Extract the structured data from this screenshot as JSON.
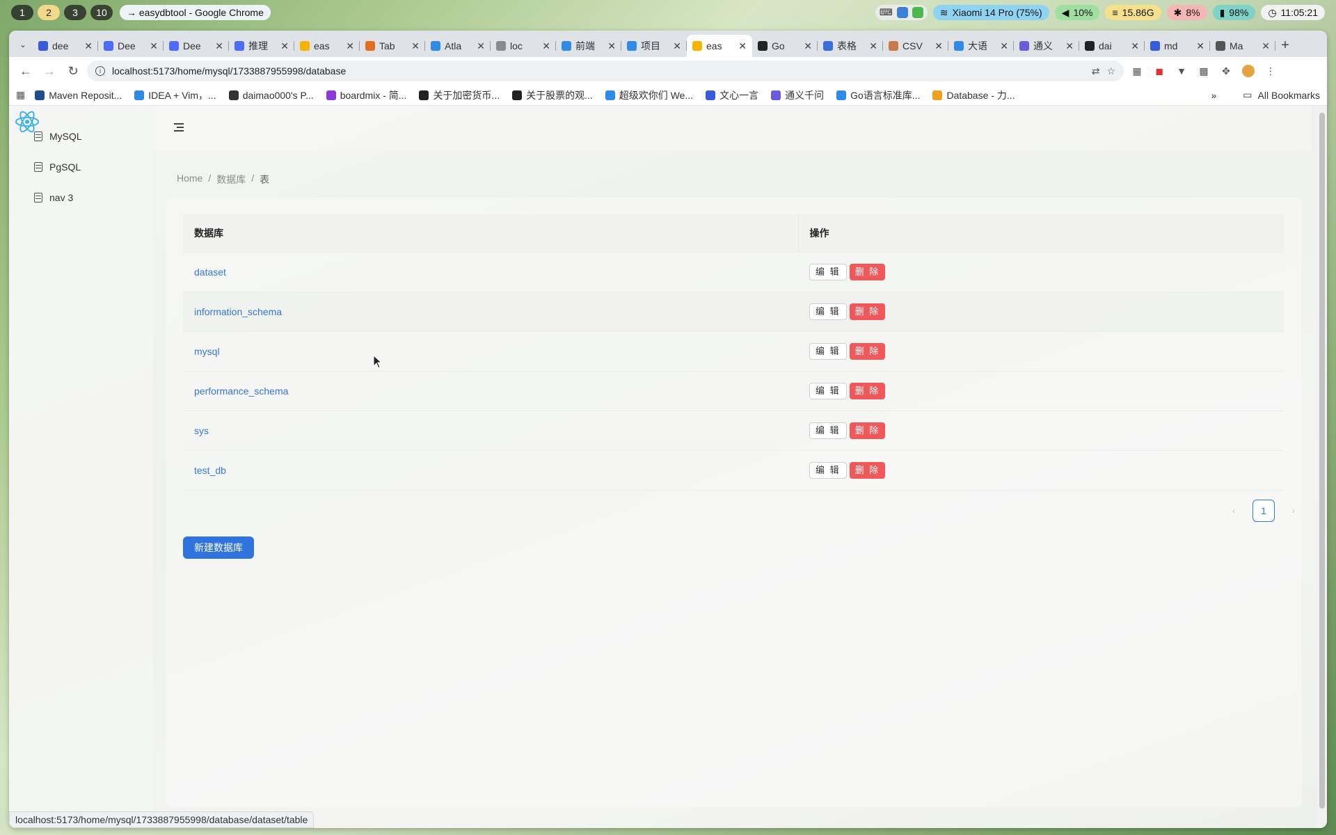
{
  "system_bar": {
    "workspaces": [
      "1",
      "2",
      "3",
      "10"
    ],
    "active_workspace": "2",
    "window_title": "→ easydbtool - Google Chrome",
    "wifi": "Xiaomi 14 Pro (75%)",
    "volume": "10%",
    "memory": "15.86G",
    "cpu": "8%",
    "battery": "98%",
    "clock": "11:05:21"
  },
  "tabs": [
    {
      "label": "dee",
      "icon": "paw-icon",
      "color": "#3a5bd9"
    },
    {
      "label": "Dee",
      "icon": "deepseek-icon",
      "color": "#4d6bfe"
    },
    {
      "label": "Dee",
      "icon": "deepseek-icon",
      "color": "#4d6bfe"
    },
    {
      "label": "推理",
      "icon": "deepseek-icon",
      "color": "#4d6bfe"
    },
    {
      "label": "eas",
      "icon": "vite-icon",
      "color": "#f5b400"
    },
    {
      "label": "Tab",
      "icon": "gear-icon",
      "color": "#e07020"
    },
    {
      "label": "Atla",
      "icon": "db-icon",
      "color": "#2f8be6"
    },
    {
      "label": "loc",
      "icon": "page-icon",
      "color": "#8a8a8a"
    },
    {
      "label": "前端",
      "icon": "send-icon",
      "color": "#2f8be6"
    },
    {
      "label": "项目",
      "icon": "notion-icon",
      "color": "#2f8be6"
    },
    {
      "label": "eas",
      "icon": "vite-icon",
      "color": "#f5b400",
      "active": true
    },
    {
      "label": "Go",
      "icon": "k-icon",
      "color": "#222222"
    },
    {
      "label": "表格",
      "icon": "diamond-icon",
      "color": "#3a6fd9"
    },
    {
      "label": "CSV",
      "icon": "avatar-icon",
      "color": "#c77b4a"
    },
    {
      "label": "大语",
      "icon": "db-icon",
      "color": "#2f8be6"
    },
    {
      "label": "通义",
      "icon": "qwen-icon",
      "color": "#6a5bd9"
    },
    {
      "label": "dai",
      "icon": "github-icon",
      "color": "#222222"
    },
    {
      "label": "md",
      "icon": "paw-icon",
      "color": "#3a5bd9"
    },
    {
      "label": "Ma",
      "icon": "link-icon",
      "color": "#555555"
    }
  ],
  "address_bar": {
    "url": "localhost:5173/home/mysql/1733887955998/database"
  },
  "bookmarks": [
    {
      "label": "Maven Reposit...",
      "color": "#1f4e8c"
    },
    {
      "label": "IDEA + Vim，...",
      "color": "#2f8be6"
    },
    {
      "label": "daimao000's P...",
      "color": "#333333"
    },
    {
      "label": "boardmix - 简...",
      "color": "#8a3ad9"
    },
    {
      "label": "关于加密货币...",
      "color": "#222222"
    },
    {
      "label": "关于股票的观...",
      "color": "#222222"
    },
    {
      "label": "超级欢你们 We...",
      "color": "#2f8be6"
    },
    {
      "label": "文心一言",
      "color": "#3a5bd9"
    },
    {
      "label": "通义千问",
      "color": "#6a5bd9"
    },
    {
      "label": "Go语言标准库...",
      "color": "#2f8be6"
    },
    {
      "label": "Database - 力...",
      "color": "#f0a020"
    }
  ],
  "all_bookmarks": "All Bookmarks",
  "sidebar": {
    "items": [
      {
        "label": "MySQL"
      },
      {
        "label": "PgSQL"
      },
      {
        "label": "nav 3"
      }
    ]
  },
  "breadcrumb": {
    "items": [
      "Home",
      "数据库",
      "表"
    ],
    "separator": "/"
  },
  "table": {
    "columns": [
      "数据库",
      "操作"
    ],
    "rows": [
      {
        "name": "dataset"
      },
      {
        "name": "information_schema"
      },
      {
        "name": "mysql"
      },
      {
        "name": "performance_schema"
      },
      {
        "name": "sys"
      },
      {
        "name": "test_db"
      }
    ],
    "edit_label": "编 辑",
    "delete_label": "删 除"
  },
  "pagination": {
    "current": "1",
    "prev": "‹",
    "next": "›"
  },
  "new_db_button": "新建数据库",
  "status_url": "localhost:5173/home/mysql/1733887955998/database/dataset/table",
  "colors": {
    "primary": "#2f73e0",
    "danger": "#f0585a",
    "link": "#3478d6"
  }
}
